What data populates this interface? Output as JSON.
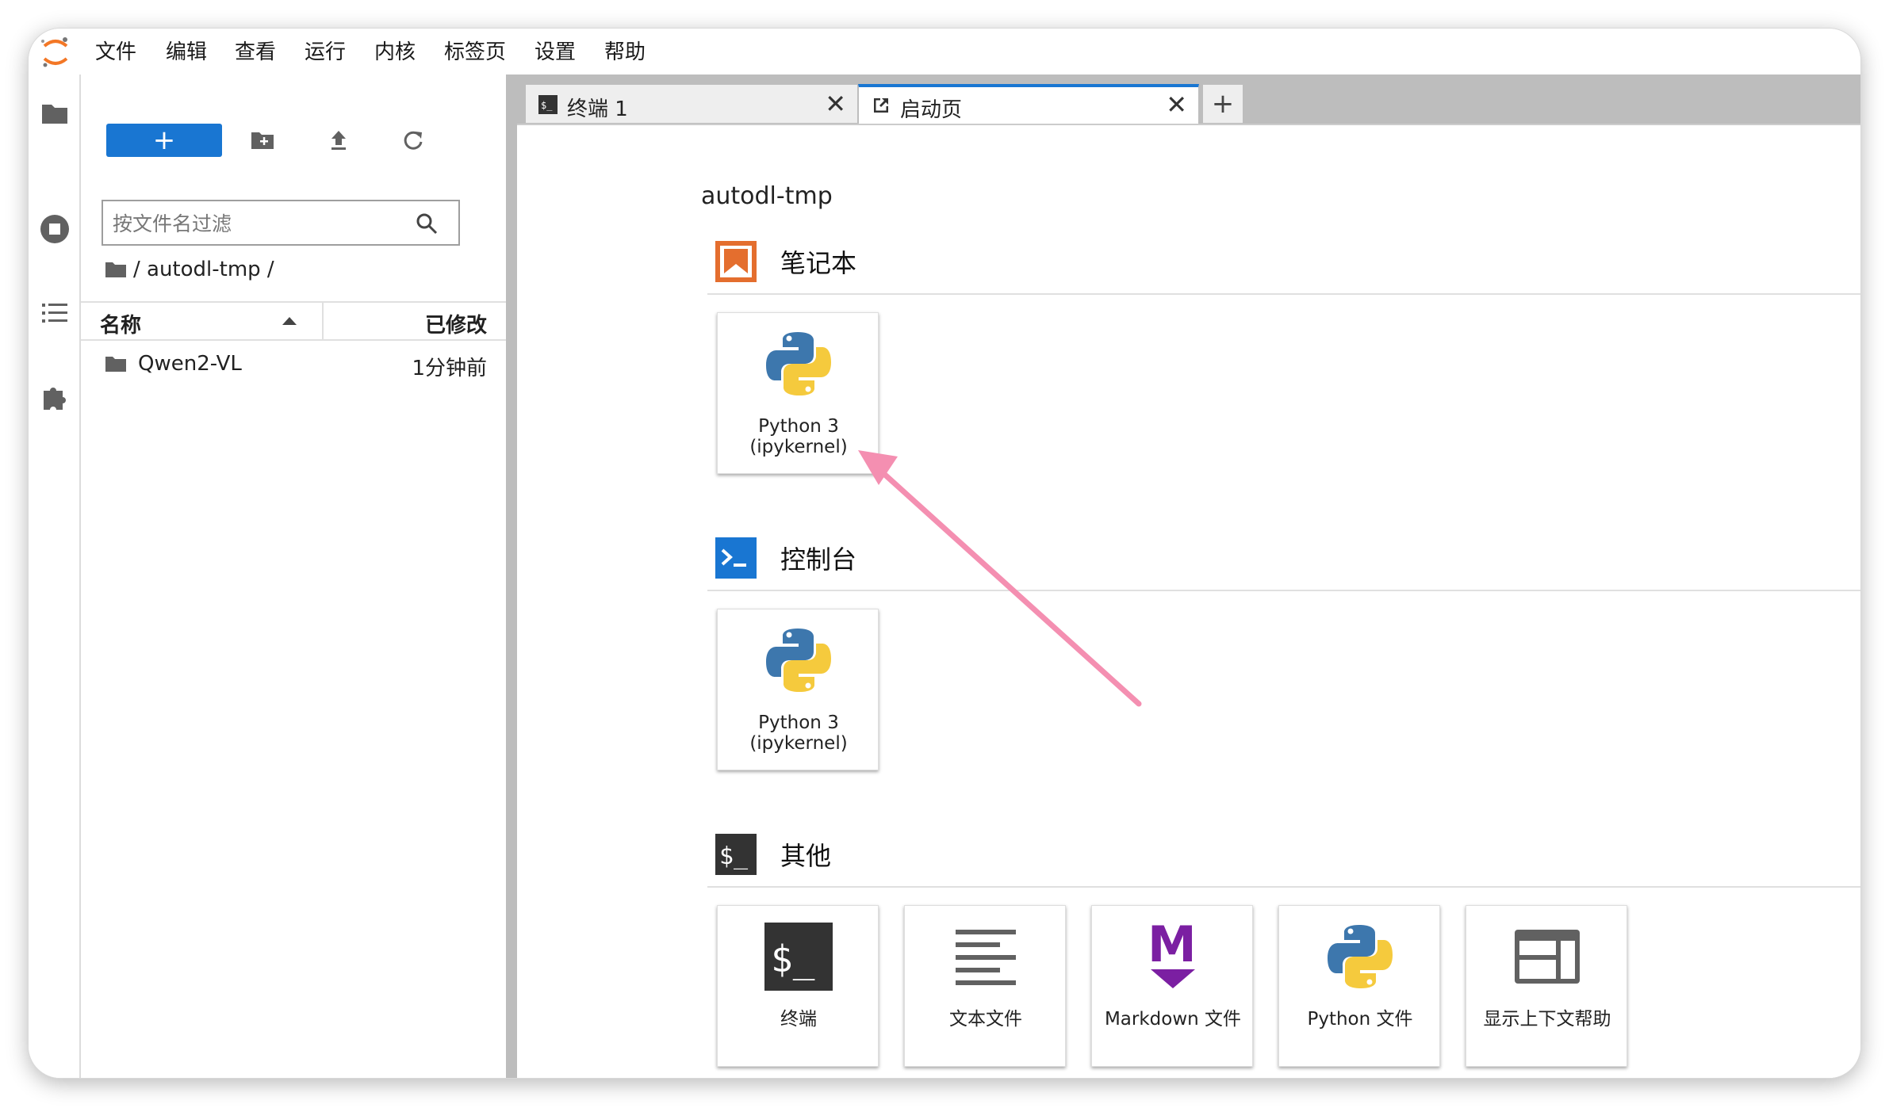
{
  "menu": {
    "items": [
      "文件",
      "编辑",
      "查看",
      "运行",
      "内核",
      "标签页",
      "设置",
      "帮助"
    ]
  },
  "rail": {
    "icons": [
      "folder-icon",
      "stop-circle-icon",
      "list-icon",
      "puzzle-icon"
    ]
  },
  "filebrowser": {
    "new_label": "+",
    "filter_placeholder": "按文件名过滤",
    "breadcrumb": "/ autodl-tmp /",
    "columns": {
      "name": "名称",
      "modified": "已修改"
    },
    "rows": [
      {
        "name": "Qwen2-VL",
        "modified": "1分钟前",
        "type": "folder"
      }
    ]
  },
  "tabs": [
    {
      "label": "终端 1",
      "icon": "terminal-icon",
      "active": false
    },
    {
      "label": "启动页",
      "icon": "launch-icon",
      "active": true
    }
  ],
  "add_tab_label": "+",
  "launcher": {
    "cwd": "autodl-tmp",
    "sections": {
      "notebook": {
        "label": "笔记本",
        "cards": [
          {
            "label": "Python 3\n(ipykernel)"
          }
        ]
      },
      "console": {
        "label": "控制台",
        "cards": [
          {
            "label": "Python 3\n(ipykernel)"
          }
        ]
      },
      "other": {
        "label": "其他",
        "cards": [
          {
            "label": "终端"
          },
          {
            "label": "文本文件"
          },
          {
            "label": "Markdown 文件"
          },
          {
            "label": "Python 文件"
          },
          {
            "label": "显示上下文帮助"
          }
        ]
      }
    }
  },
  "colors": {
    "accent": "#1976d2",
    "arrow": "#f48fb1",
    "notebook_icon": "#e46e2e",
    "markdown": "#7b1fa2"
  }
}
